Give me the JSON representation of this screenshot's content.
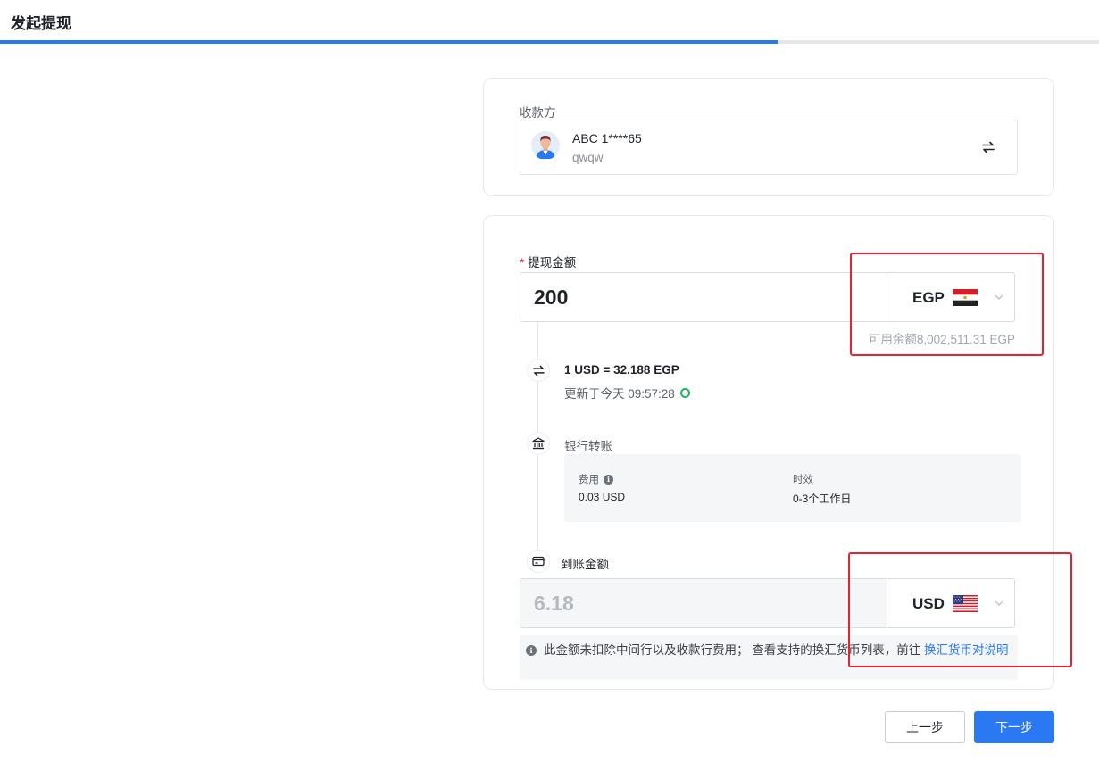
{
  "header": {
    "title": "发起提现",
    "progress": 0.708
  },
  "payee": {
    "label": "收款方",
    "name": "ABC 1****65",
    "sub": "qwqw"
  },
  "withdraw": {
    "label": "提现金额",
    "amount": "200",
    "currency": "EGP",
    "balance": "可用余额8,002,511.31 EGP"
  },
  "rate": {
    "text": "1 USD = 32.188 EGP",
    "updated": "更新于今天 09:57:28"
  },
  "bank": {
    "title": "银行转账",
    "fee_label": "费用",
    "fee_value": "0.03 USD",
    "time_label": "时效",
    "time_value": "0-3个工作日"
  },
  "receive": {
    "label": "到账金额",
    "amount": "6.18",
    "currency": "USD",
    "notice": "此金额未扣除中间行以及收款行费用； 查看支持的换汇货币列表，前往 ",
    "notice_link": "换汇货币对说明"
  },
  "footer": {
    "prev_label": "上一步",
    "next_label": "下一步"
  },
  "colors": {
    "accent": "#2a79f3",
    "highlight": "#e8232f",
    "success": "#22b35e"
  }
}
